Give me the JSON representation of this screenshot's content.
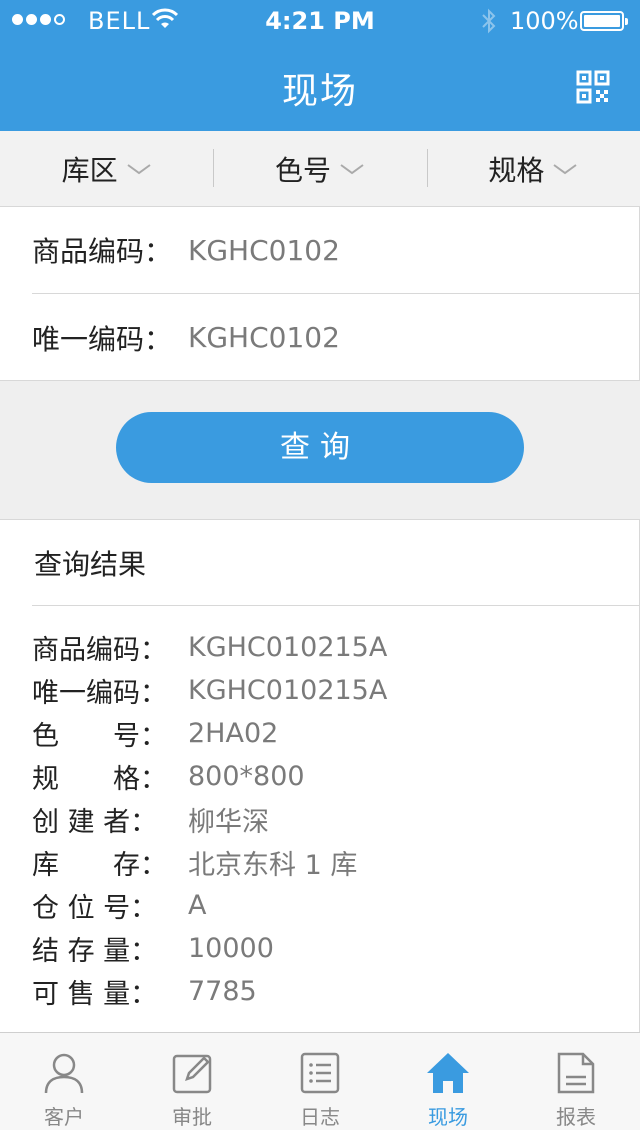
{
  "status_bar": {
    "carrier": "BELL",
    "time": "4:21 PM",
    "battery": "100%"
  },
  "header": {
    "title": "现场",
    "qr_icon": "qr-code-icon"
  },
  "filters": [
    {
      "label": "库区"
    },
    {
      "label": "色号"
    },
    {
      "label": "规格"
    }
  ],
  "search": {
    "product_code_label": "商品编码：",
    "product_code_value": "KGHC0102",
    "unique_code_label": "唯一编码：",
    "unique_code_value": "KGHC0102"
  },
  "query_button": "查询",
  "result": {
    "title": "查询结果",
    "rows": [
      {
        "label": "商品编码：",
        "value": "KGHC010215A"
      },
      {
        "label": "唯一编码：",
        "value": "KGHC010215A"
      },
      {
        "label": "色　　号：",
        "value": "2HA02"
      },
      {
        "label": "规　　格：",
        "value": "800*800"
      },
      {
        "label": "创 建 者：",
        "value": "柳华深"
      },
      {
        "label": "库　　存：",
        "value": "北京东科 1 库"
      },
      {
        "label": "仓 位 号：",
        "value": "A"
      },
      {
        "label": "结 存 量：",
        "value": "10000"
      },
      {
        "label": "可 售 量：",
        "value": "7785"
      }
    ]
  },
  "tabs": [
    {
      "label": "客户",
      "icon": "person-icon"
    },
    {
      "label": "审批",
      "icon": "edit-icon"
    },
    {
      "label": "日志",
      "icon": "list-icon"
    },
    {
      "label": "现场",
      "icon": "home-icon",
      "active": true
    },
    {
      "label": "报表",
      "icon": "document-icon"
    }
  ],
  "colors": {
    "primary": "#3a9be0",
    "background": "#efefef",
    "value_gray": "#7a7a7a"
  }
}
